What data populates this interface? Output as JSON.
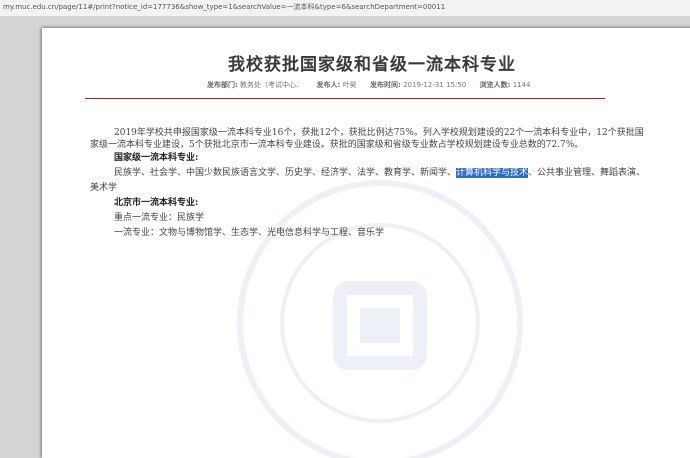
{
  "browser": {
    "url": "my.muc.edu.cn/page/11#/print?notice_id=177736&show_type=1&searchValue=一流本科&type=6&searchDepartment=00011"
  },
  "article": {
    "title": "我校获批国家级和省级一流本科专业",
    "meta": {
      "dept_label": "发布部门:",
      "dept_value": "教务处（考试中心、",
      "publisher_label": "发布人:",
      "publisher_value": "叶昊",
      "time_label": "发布时间:",
      "time_value": "2019-12-31 15:50",
      "views_label": "浏览人数:",
      "views_value": "1144"
    },
    "intro": "2019年学校共申报国家级一流本科专业16个，获批12个，获批比例达75%。列入学校规划建设的22个一流本科专业中，12个获批国家级一流本科专业建设，5个获批北京市一流本科专业建设。获批的国家级和省级专业数占学校规划建设专业总数的72.7%。",
    "national_heading": "国家级一流本科专业:",
    "national_list_before": "民族学、社会学、中国少数民族语言文学、历史学、经济学、法学、教育学、新闻学、",
    "national_list_highlight": "计算机科学与技术",
    "national_list_after": "、公共事业管理、舞蹈表演、美术学",
    "beijing_heading": "北京市一流本科专业:",
    "beijing_key": "重点一流专业：民族学",
    "beijing_general": "一流专业：文物与博物馆学、生态学、光电信息科学与工程、音乐学"
  }
}
